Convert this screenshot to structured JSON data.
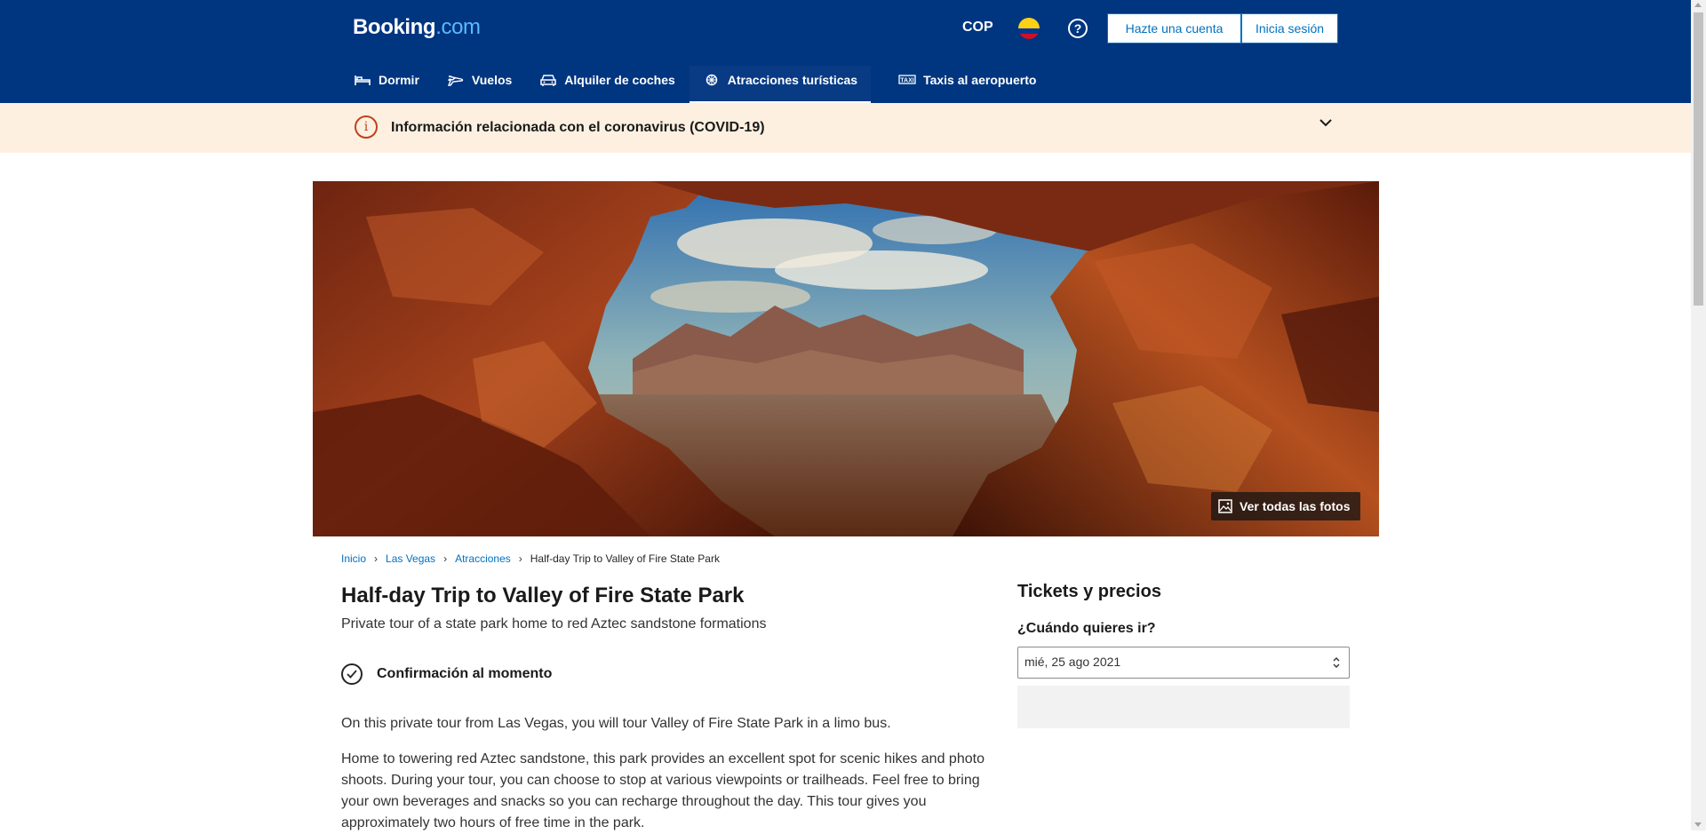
{
  "header": {
    "logo_main": "Booking",
    "logo_suffix": ".com",
    "currency": "COP",
    "register_label": "Hazte una cuenta",
    "login_label": "Inicia sesión"
  },
  "nav": {
    "items": [
      {
        "label": "Dormir",
        "icon": "bed-icon"
      },
      {
        "label": "Vuelos",
        "icon": "plane-icon"
      },
      {
        "label": "Alquiler de coches",
        "icon": "car-icon"
      },
      {
        "label": "Atracciones turísticas",
        "icon": "attractions-icon",
        "active": true
      },
      {
        "label": "Taxis al aeropuerto",
        "icon": "taxi-icon"
      }
    ]
  },
  "covid": {
    "text": "Información relacionada con el coronavirus (COVID-19)"
  },
  "hero": {
    "photos_label": "Ver todas las fotos"
  },
  "breadcrumb": {
    "items": [
      "Inicio",
      "Las Vegas",
      "Atracciones"
    ],
    "current": "Half-day Trip to Valley of Fire State Park"
  },
  "attraction": {
    "title": "Half-day Trip to Valley of Fire State Park",
    "subtitle": "Private tour of a state park home to red Aztec sandstone formations",
    "confirmation": "Confirmación al momento",
    "paragraphs": [
      "On this private tour from Las Vegas, you will tour Valley of Fire State Park in a limo bus.",
      "Home to towering red Aztec sandstone, this park provides an excellent spot for scenic hikes and photo shoots. During your tour, you can choose to stop at various viewpoints or trailheads. Feel free to bring your own beverages and snacks so you can recharge throughout the day. This tour gives you approximately two hours of free time in the park."
    ]
  },
  "tickets": {
    "title": "Tickets y precios",
    "when_label": "¿Cuándo quieres ir?",
    "selected_date": "mié, 25 ago 2021"
  },
  "colors": {
    "brand_blue": "#003580",
    "link_blue": "#0071c2",
    "covid_bg": "#fef0e0"
  }
}
